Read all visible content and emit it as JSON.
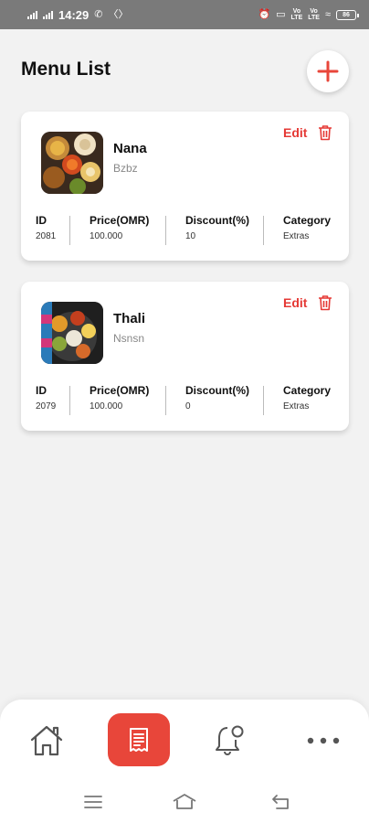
{
  "status_bar": {
    "time": "14:29",
    "battery": "86"
  },
  "header": {
    "title": "Menu List",
    "add_button_icon": "plus-icon"
  },
  "stat_labels": {
    "id": "ID",
    "price": "Price(OMR)",
    "discount": "Discount(%)",
    "category": "Category"
  },
  "actions": {
    "edit_label": "Edit",
    "delete_icon": "trash-icon"
  },
  "menu_items": [
    {
      "name": "Nana",
      "description": "Bzbz",
      "id": "2081",
      "price": "100.000",
      "discount": "10",
      "category": "Extras"
    },
    {
      "name": "Thali",
      "description": "Nsnsn",
      "id": "2079",
      "price": "100.000",
      "discount": "0",
      "category": "Extras"
    }
  ],
  "bottom_nav": {
    "items": [
      {
        "icon": "home-icon"
      },
      {
        "icon": "menu-list-icon",
        "active": true
      },
      {
        "icon": "bell-icon"
      },
      {
        "icon": "more-icon"
      }
    ]
  },
  "colors": {
    "accent": "#e8463a",
    "background": "#f2f2f2",
    "card": "#ffffff"
  }
}
